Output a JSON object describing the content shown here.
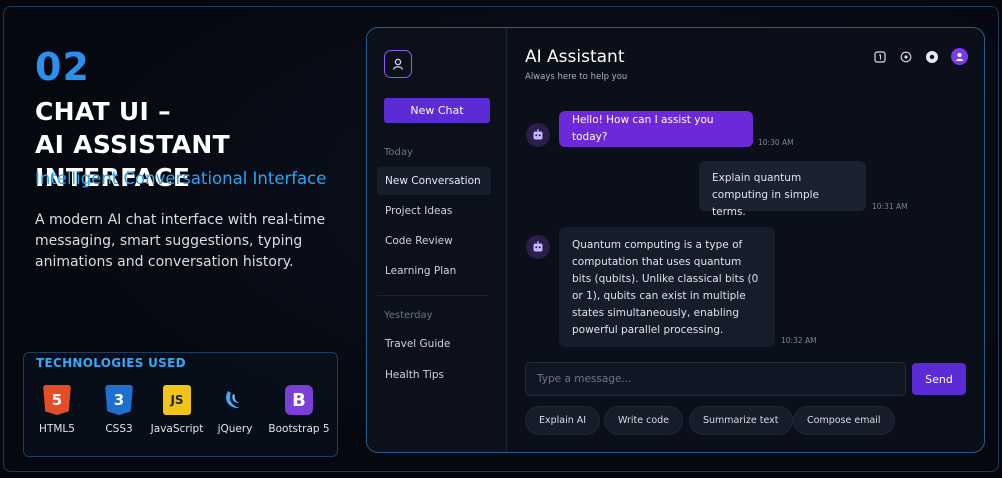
{
  "showcase": {
    "number": "02",
    "title_line1": "CHAT UI –",
    "title_line2": "AI ASSISTANT INTERFACE",
    "subtitle": "Intelligent Conversational Interface",
    "description": "A modern AI chat interface with real-time messaging, smart suggestions, typing animations and conversation history.",
    "tech_title": "TECHNOLOGIES USED",
    "technologies": [
      {
        "label": "HTML5",
        "icon": "html5-icon",
        "glyph": "5"
      },
      {
        "label": "CSS3",
        "icon": "css3-icon",
        "glyph": "3"
      },
      {
        "label": "JavaScript",
        "icon": "javascript-icon",
        "glyph": "JS"
      },
      {
        "label": "jQuery",
        "icon": "jquery-icon",
        "glyph": ""
      },
      {
        "label": "Bootstrap 5",
        "icon": "bootstrap-icon",
        "glyph": "B"
      }
    ]
  },
  "app": {
    "sidebar": {
      "new_chat_label": "New Chat",
      "today_label": "Today",
      "today_items": [
        "New Conversation",
        "Project Ideas",
        "Code Review",
        "Learning Plan"
      ],
      "yesterday_label": "Yesterday",
      "yesterday_items": [
        "Travel Guide",
        "Health Tips"
      ]
    },
    "header": {
      "title": "AI Assistant",
      "subtitle": "Always here to help you"
    },
    "messages": [
      {
        "from": "bot",
        "text": "Hello! How can I assist you today?",
        "time": "10:30 AM"
      },
      {
        "from": "user",
        "text": "Explain quantum computing in simple terms.",
        "time": "10:31 AM"
      },
      {
        "from": "bot",
        "text": "Quantum computing is a type of computation that uses quantum bits (qubits). Unlike classical bits (0 or 1), qubits can exist in multiple states simultaneously, enabling powerful parallel processing.",
        "time": "10:32 AM"
      }
    ],
    "input": {
      "placeholder": "Type a message...",
      "value": ""
    },
    "send_label": "Send",
    "suggestions": [
      "Explain AI",
      "Write code",
      "Summarize text",
      "Compose email"
    ]
  },
  "colors": {
    "accent": "#5b2bd6",
    "bot_bubble": "#6d28d9",
    "heading_blue": "#2b8ff0"
  }
}
